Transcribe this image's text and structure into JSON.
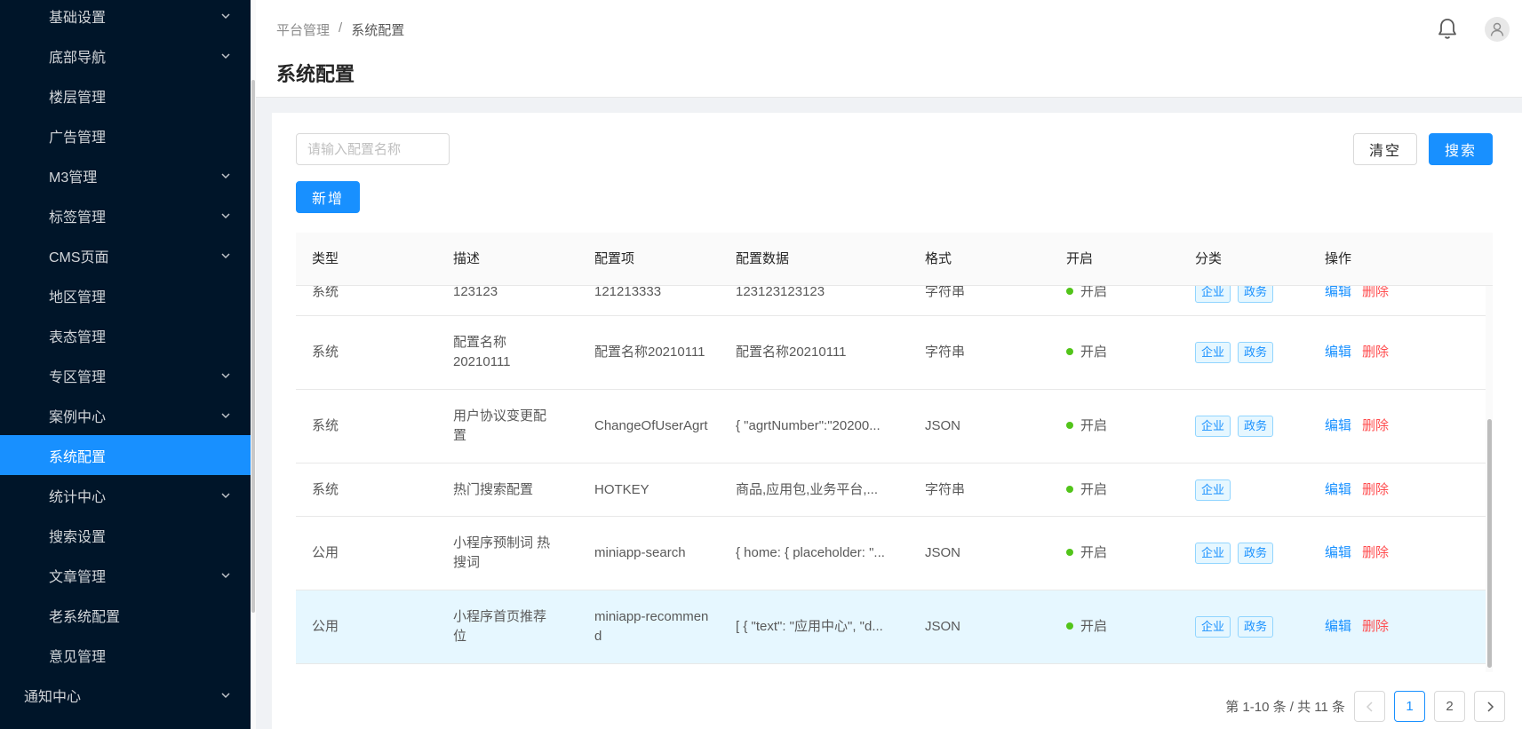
{
  "sidebar": {
    "items": [
      {
        "label": "基础设置",
        "expand": true,
        "level": "sub"
      },
      {
        "label": "底部导航",
        "expand": true,
        "level": "sub"
      },
      {
        "label": "楼层管理",
        "expand": false,
        "level": "sub"
      },
      {
        "label": "广告管理",
        "expand": false,
        "level": "sub"
      },
      {
        "label": "M3管理",
        "expand": true,
        "level": "sub"
      },
      {
        "label": "标签管理",
        "expand": true,
        "level": "sub"
      },
      {
        "label": "CMS页面",
        "expand": true,
        "level": "sub"
      },
      {
        "label": "地区管理",
        "expand": false,
        "level": "sub"
      },
      {
        "label": "表态管理",
        "expand": false,
        "level": "sub"
      },
      {
        "label": "专区管理",
        "expand": true,
        "level": "sub"
      },
      {
        "label": "案例中心",
        "expand": true,
        "level": "sub"
      },
      {
        "label": "系统配置",
        "expand": false,
        "level": "sub",
        "active": true
      },
      {
        "label": "统计中心",
        "expand": true,
        "level": "sub"
      },
      {
        "label": "搜索设置",
        "expand": false,
        "level": "sub"
      },
      {
        "label": "文章管理",
        "expand": true,
        "level": "sub"
      },
      {
        "label": "老系统配置",
        "expand": false,
        "level": "sub"
      },
      {
        "label": "意见管理",
        "expand": false,
        "level": "sub"
      },
      {
        "label": "通知中心",
        "expand": true,
        "level": "top"
      }
    ]
  },
  "header": {
    "breadcrumb": [
      "平台管理",
      "系统配置"
    ],
    "breadcrumb_sep": "/",
    "title": "系统配置"
  },
  "toolbar": {
    "search_placeholder": "请输入配置名称",
    "clear_label": "清空",
    "search_label": "搜索",
    "add_label": "新增"
  },
  "table": {
    "columns": [
      "类型",
      "描述",
      "配置项",
      "配置数据",
      "格式",
      "开启",
      "分类",
      "操作"
    ],
    "rows": [
      {
        "type": "系统",
        "desc": "123123",
        "key": "121213333",
        "data": "123123123123",
        "format": "字符串",
        "status": "开启",
        "tags": [
          "企业",
          "政务"
        ]
      },
      {
        "type": "系统",
        "desc": "配置名称20210111",
        "key": "配置名称20210111",
        "data": "配置名称20210111",
        "format": "字符串",
        "status": "开启",
        "tags": [
          "企业",
          "政务"
        ]
      },
      {
        "type": "系统",
        "desc": "用户协议变更配置",
        "key": "ChangeOfUserAgrt",
        "data": "{ \"agrtNumber\":\"20200...",
        "format": "JSON",
        "status": "开启",
        "tags": [
          "企业",
          "政务"
        ]
      },
      {
        "type": "系统",
        "desc": "热门搜索配置",
        "key": "HOTKEY",
        "data": "商品,应用包,业务平台,...",
        "format": "字符串",
        "status": "开启",
        "tags": [
          "企业"
        ]
      },
      {
        "type": "公用",
        "desc": "小程序预制词 热搜词",
        "key": "miniapp-search",
        "data": "{ home: { placeholder: \"...",
        "format": "JSON",
        "status": "开启",
        "tags": [
          "企业",
          "政务"
        ]
      },
      {
        "type": "公用",
        "desc": "小程序首页推荐位",
        "key": "miniapp-recommend",
        "data": "[ { \"text\": \"应用中心\", \"d...",
        "format": "JSON",
        "status": "开启",
        "tags": [
          "企业",
          "政务"
        ],
        "highlight": true
      }
    ],
    "edit_label": "编辑",
    "delete_label": "删除"
  },
  "pagination": {
    "summary": "第 1-10 条 / 共 11 条",
    "pages": [
      "1",
      "2"
    ],
    "current": "1"
  }
}
